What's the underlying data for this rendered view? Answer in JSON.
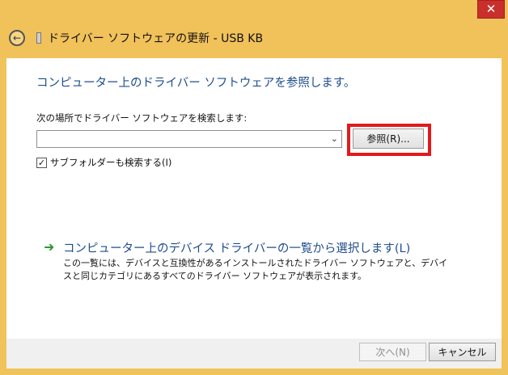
{
  "window": {
    "title": "ドライバー ソフトウェアの更新 - USB KB",
    "close_glyph": "✕"
  },
  "icons": {
    "back": "arrow-left-icon",
    "device": "usb-device-icon",
    "link": "green-arrow-icon"
  },
  "main": {
    "heading": "コンピューター上のドライバー ソフトウェアを参照します。",
    "search_label": "次の場所でドライバー ソフトウェアを検索します:",
    "path_value": "",
    "browse_label": "参照(R)...",
    "include_subfolders_label": "サブフォルダーも検索する(I)",
    "include_subfolders_checked": true,
    "list_link_title": "コンピューター上のデバイス ドライバーの一覧から選択します(L)",
    "list_link_desc": "この一覧には、デバイスと互換性があるインストールされたドライバー ソフトウェアと、デバイスと同じカテゴリにあるすべてのドライバー ソフトウェアが表示されます。"
  },
  "footer": {
    "next_label": "次へ(N)",
    "next_disabled": true,
    "cancel_label": "キャンセル"
  },
  "colors": {
    "frame": "#f0c45a",
    "heading": "#1f4e8d",
    "highlight": "#e3191b",
    "close": "#c9302c"
  }
}
